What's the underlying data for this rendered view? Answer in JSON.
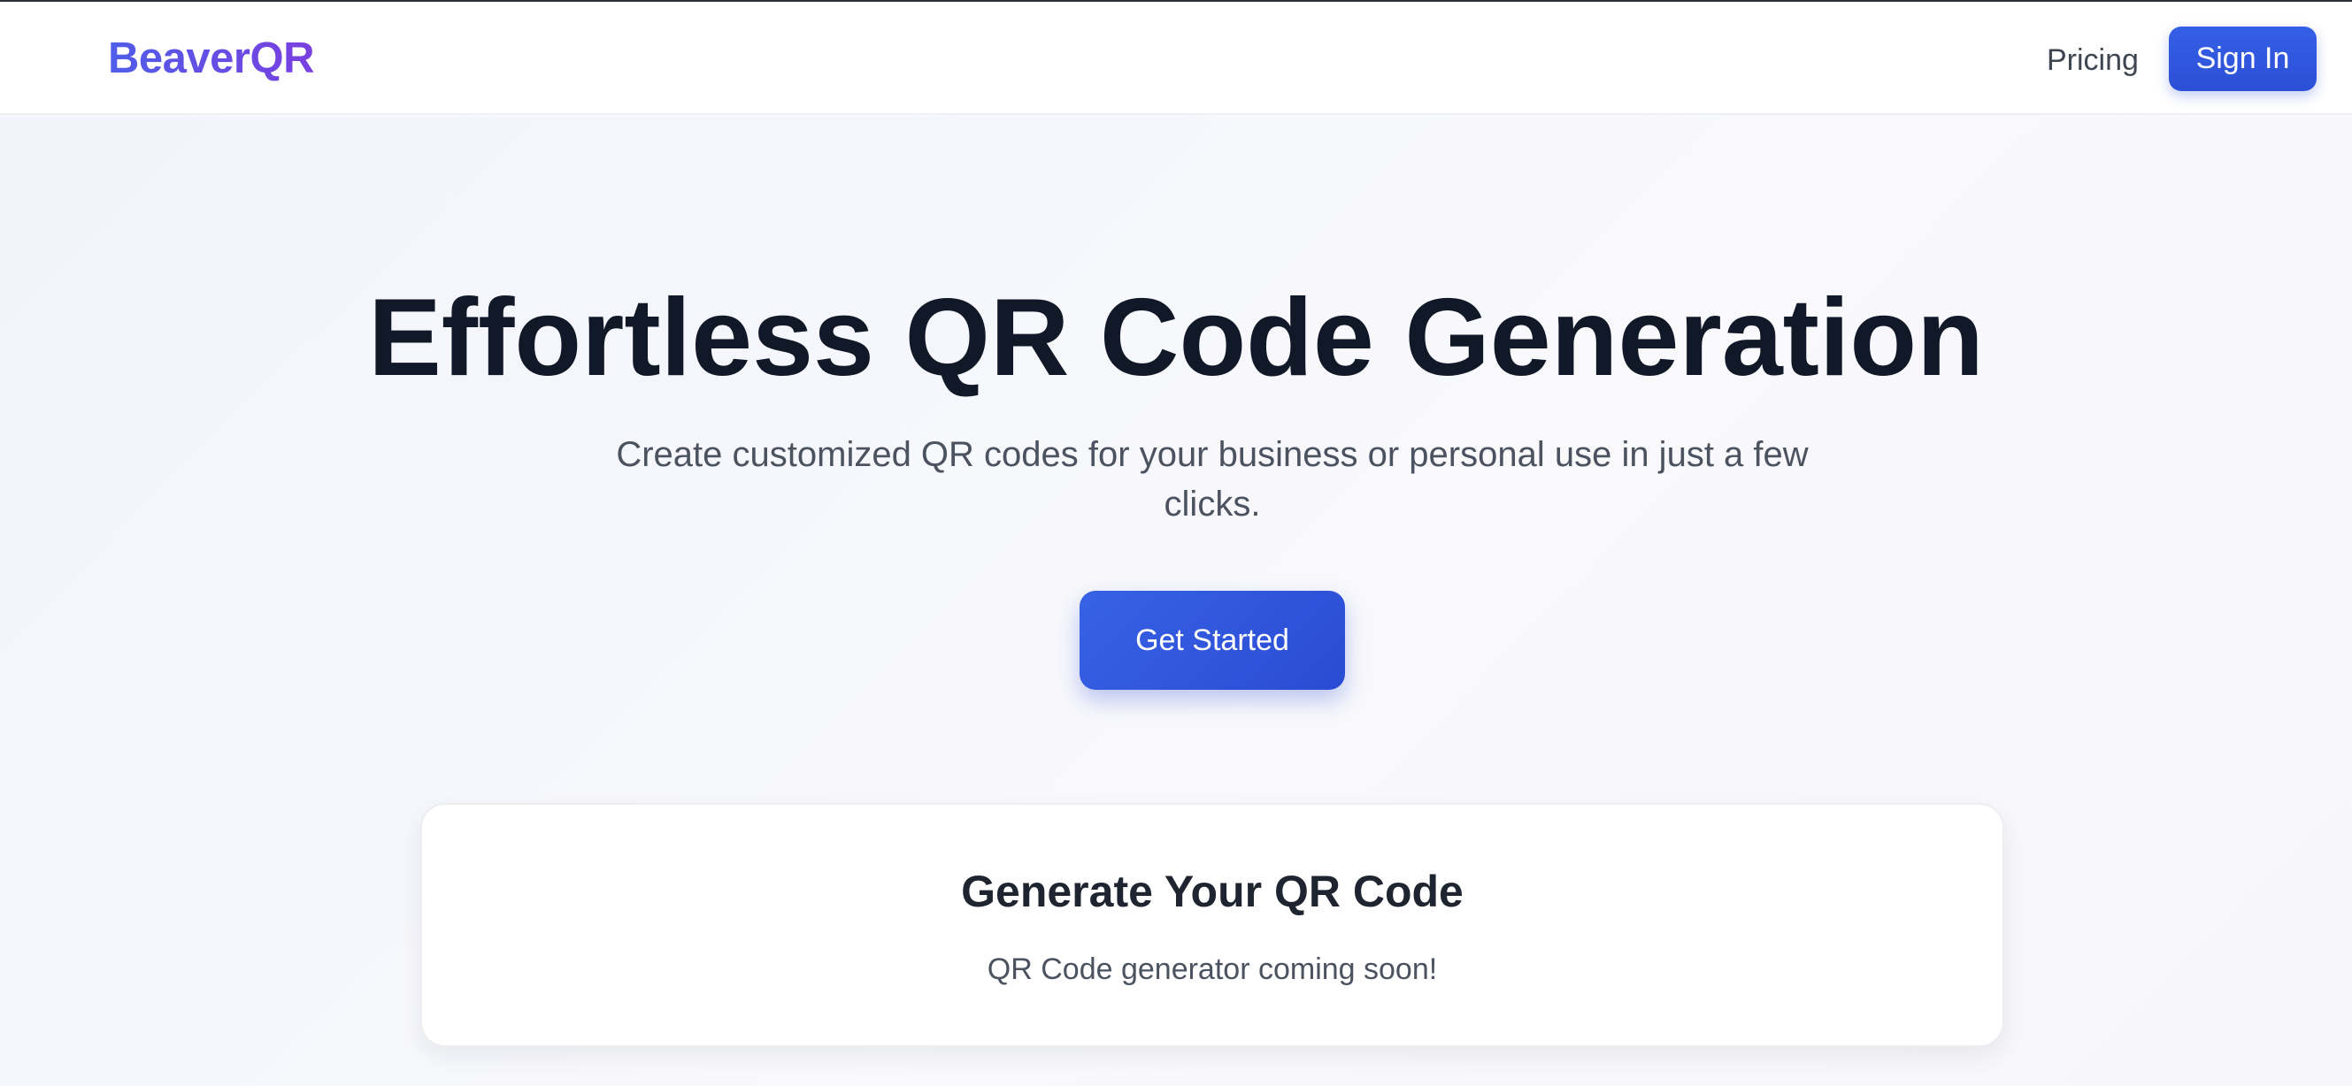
{
  "nav": {
    "logo": "BeaverQR",
    "links": [
      {
        "label": "Pricing"
      }
    ],
    "signin_label": "Sign In"
  },
  "hero": {
    "title": "Effortless QR Code Generation",
    "subtitle": "Create customized QR codes for your business or personal use in just a few clicks.",
    "cta_label": "Get Started"
  },
  "generator_card": {
    "title": "Generate Your QR Code",
    "message": "QR Code generator coming soon!"
  },
  "colors": {
    "primary": "#2f56e0",
    "logo_gradient_start": "#4f5ee8",
    "logo_gradient_end": "#7a3fe0",
    "heading_text": "#111827",
    "body_text": "#4b5260"
  }
}
